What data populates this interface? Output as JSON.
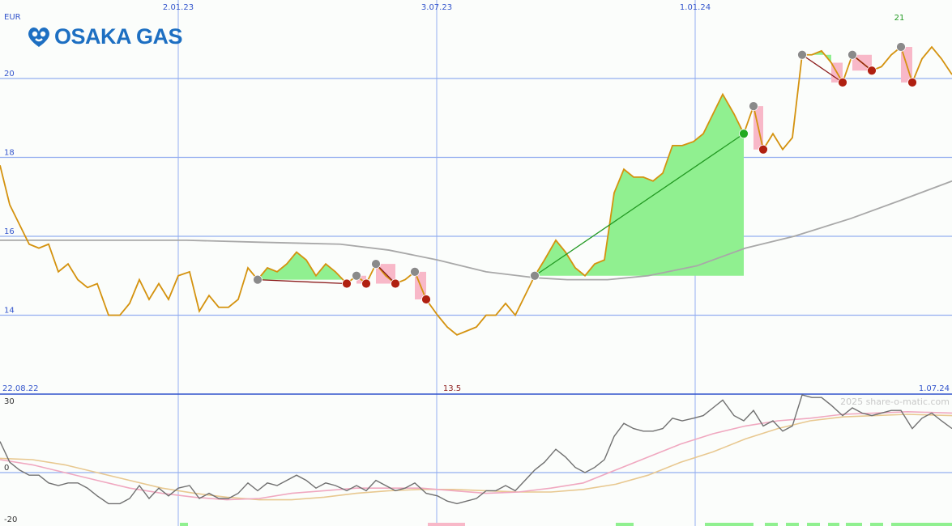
{
  "brand": {
    "name": "OSAKA GAS",
    "color": "#1d6fc2"
  },
  "currency": "EUR",
  "watermark": "2025 share-o-matic.com",
  "chart_data": [
    {
      "type": "line",
      "name": "price-panel",
      "x_tick_labels": [
        "2.01.23",
        "3.07.23",
        "1.01.24"
      ],
      "y_ticks": [
        14,
        16,
        18,
        20
      ],
      "ylim": [
        12.0,
        21.8
      ],
      "start_date_label": "22.08.22",
      "end_date_label": "1.07.24",
      "low_marker_label": "13.5",
      "high_marker_label": "21",
      "grid": true,
      "colors": {
        "price": "#d4920e",
        "moving_average": "#a8a8a8",
        "up_fill": "#90f090",
        "down_fill": "#f8b8c8",
        "trend_up": "#229922",
        "trend_down": "#8b1a1a",
        "grid": "#94aef0",
        "axis_text": "#3355cc"
      },
      "price": [
        [
          0,
          17.8
        ],
        [
          12,
          16.8
        ],
        [
          24,
          16.3
        ],
        [
          36,
          15.8
        ],
        [
          48,
          15.7
        ],
        [
          60,
          15.8
        ],
        [
          72,
          15.1
        ],
        [
          84,
          15.3
        ],
        [
          96,
          14.9
        ],
        [
          108,
          14.7
        ],
        [
          120,
          14.8
        ],
        [
          134,
          14.0
        ],
        [
          148,
          14.0
        ],
        [
          160,
          14.3
        ],
        [
          172,
          14.9
        ],
        [
          184,
          14.4
        ],
        [
          196,
          14.8
        ],
        [
          208,
          14.4
        ],
        [
          220,
          15.0
        ],
        [
          234,
          15.1
        ],
        [
          246,
          14.1
        ],
        [
          258,
          14.5
        ],
        [
          270,
          14.2
        ],
        [
          282,
          14.2
        ],
        [
          294,
          14.4
        ],
        [
          306,
          15.2
        ],
        [
          318,
          14.9
        ],
        [
          330,
          15.2
        ],
        [
          342,
          15.1
        ],
        [
          354,
          15.3
        ],
        [
          366,
          15.6
        ],
        [
          378,
          15.4
        ],
        [
          390,
          15.0
        ],
        [
          402,
          15.3
        ],
        [
          414,
          15.1
        ],
        [
          428,
          14.8
        ],
        [
          440,
          15.0
        ],
        [
          452,
          14.8
        ],
        [
          464,
          15.3
        ],
        [
          476,
          15.0
        ],
        [
          488,
          14.8
        ],
        [
          500,
          14.9
        ],
        [
          512,
          15.1
        ],
        [
          526,
          14.4
        ],
        [
          540,
          14.0
        ],
        [
          552,
          13.7
        ],
        [
          564,
          13.5
        ],
        [
          576,
          13.6
        ],
        [
          588,
          13.7
        ],
        [
          600,
          14.0
        ],
        [
          612,
          14.0
        ],
        [
          624,
          14.3
        ],
        [
          636,
          14.0
        ],
        [
          648,
          14.5
        ],
        [
          660,
          15.0
        ],
        [
          672,
          15.4
        ],
        [
          686,
          15.9
        ],
        [
          698,
          15.6
        ],
        [
          710,
          15.2
        ],
        [
          722,
          15.0
        ],
        [
          734,
          15.3
        ],
        [
          746,
          15.4
        ],
        [
          758,
          17.1
        ],
        [
          770,
          17.7
        ],
        [
          782,
          17.5
        ],
        [
          794,
          17.5
        ],
        [
          806,
          17.4
        ],
        [
          818,
          17.6
        ],
        [
          830,
          18.3
        ],
        [
          842,
          18.3
        ],
        [
          856,
          18.4
        ],
        [
          868,
          18.6
        ],
        [
          880,
          19.1
        ],
        [
          892,
          19.6
        ],
        [
          906,
          19.1
        ],
        [
          918,
          18.6
        ],
        [
          930,
          19.3
        ],
        [
          942,
          18.2
        ],
        [
          954,
          18.6
        ],
        [
          966,
          18.2
        ],
        [
          978,
          18.5
        ],
        [
          990,
          20.6
        ],
        [
          1002,
          20.6
        ],
        [
          1014,
          20.7
        ],
        [
          1026,
          20.4
        ],
        [
          1040,
          19.9
        ],
        [
          1052,
          20.6
        ],
        [
          1064,
          20.4
        ],
        [
          1076,
          20.2
        ],
        [
          1088,
          20.3
        ],
        [
          1100,
          20.6
        ],
        [
          1112,
          20.8
        ],
        [
          1126,
          19.9
        ],
        [
          1138,
          20.5
        ],
        [
          1150,
          20.8
        ],
        [
          1162,
          20.5
        ],
        [
          1175,
          20.1
        ]
      ],
      "moving_average": [
        [
          0,
          15.9
        ],
        [
          100,
          15.9
        ],
        [
          230,
          15.9
        ],
        [
          320,
          15.85
        ],
        [
          420,
          15.8
        ],
        [
          480,
          15.65
        ],
        [
          540,
          15.4
        ],
        [
          600,
          15.1
        ],
        [
          660,
          14.95
        ],
        [
          700,
          14.9
        ],
        [
          750,
          14.9
        ],
        [
          800,
          15.0
        ],
        [
          860,
          15.25
        ],
        [
          920,
          15.7
        ],
        [
          980,
          16.0
        ],
        [
          1050,
          16.45
        ],
        [
          1110,
          16.9
        ],
        [
          1175,
          17.4
        ]
      ],
      "up_fills": [
        {
          "from": 318,
          "to": 428,
          "base": 14.9
        },
        {
          "from": 660,
          "to": 918,
          "base": 15.0
        },
        {
          "from": 990,
          "to": 1026,
          "base": 20.6
        }
      ],
      "down_fills": [
        {
          "from": 440,
          "to": 452,
          "top": 15.0,
          "bottom": 14.8
        },
        {
          "from": 464,
          "to": 488,
          "top": 15.3,
          "bottom": 14.8
        },
        {
          "from": 512,
          "to": 526,
          "top": 15.1,
          "bottom": 14.4
        },
        {
          "from": 930,
          "to": 942,
          "top": 19.3,
          "bottom": 18.2
        },
        {
          "from": 1026,
          "to": 1040,
          "top": 20.4,
          "bottom": 19.9
        },
        {
          "from": 1052,
          "to": 1076,
          "top": 20.6,
          "bottom": 20.2
        },
        {
          "from": 1112,
          "to": 1126,
          "top": 20.8,
          "bottom": 19.9
        }
      ],
      "trend_segments": [
        {
          "x1": 318,
          "y1": 14.9,
          "x2": 428,
          "y2": 14.8,
          "dir": "down"
        },
        {
          "x1": 464,
          "y1": 15.3,
          "x2": 488,
          "y2": 14.8,
          "dir": "down"
        },
        {
          "x1": 660,
          "y1": 15.0,
          "x2": 918,
          "y2": 18.6,
          "dir": "up"
        },
        {
          "x1": 990,
          "y1": 20.6,
          "x2": 1040,
          "y2": 19.9,
          "dir": "down"
        },
        {
          "x1": 1052,
          "y1": 20.6,
          "x2": 1076,
          "y2": 20.2,
          "dir": "down"
        }
      ],
      "markers": [
        {
          "x": 318,
          "y": 14.9,
          "kind": "grey"
        },
        {
          "x": 428,
          "y": 14.8,
          "kind": "red"
        },
        {
          "x": 440,
          "y": 15.0,
          "kind": "grey"
        },
        {
          "x": 452,
          "y": 14.8,
          "kind": "red"
        },
        {
          "x": 464,
          "y": 15.3,
          "kind": "grey"
        },
        {
          "x": 488,
          "y": 14.8,
          "kind": "red"
        },
        {
          "x": 512,
          "y": 15.1,
          "kind": "grey"
        },
        {
          "x": 526,
          "y": 14.4,
          "kind": "red"
        },
        {
          "x": 660,
          "y": 15.0,
          "kind": "grey"
        },
        {
          "x": 918,
          "y": 18.6,
          "kind": "green"
        },
        {
          "x": 930,
          "y": 19.3,
          "kind": "grey"
        },
        {
          "x": 942,
          "y": 18.2,
          "kind": "red"
        },
        {
          "x": 990,
          "y": 20.6,
          "kind": "grey"
        },
        {
          "x": 1040,
          "y": 19.9,
          "kind": "red"
        },
        {
          "x": 1052,
          "y": 20.6,
          "kind": "grey"
        },
        {
          "x": 1076,
          "y": 20.2,
          "kind": "red"
        },
        {
          "x": 1112,
          "y": 20.8,
          "kind": "grey"
        },
        {
          "x": 1126,
          "y": 19.9,
          "kind": "red"
        }
      ]
    },
    {
      "type": "line",
      "name": "momentum-panel",
      "y_ticks": [
        30,
        0,
        -20
      ],
      "ylim": [
        -20,
        30
      ],
      "colors": {
        "momentum": "#707070",
        "fast_avg": "#f0a8c0",
        "slow_avg": "#e8c890",
        "pos_bar": "#90f090",
        "neg_bar": "#f8b8c8"
      },
      "momentum": [
        [
          0,
          12
        ],
        [
          12,
          4
        ],
        [
          24,
          1
        ],
        [
          36,
          -1
        ],
        [
          48,
          -1
        ],
        [
          60,
          -4
        ],
        [
          72,
          -5
        ],
        [
          84,
          -4
        ],
        [
          96,
          -4
        ],
        [
          108,
          -6
        ],
        [
          120,
          -9
        ],
        [
          134,
          -12
        ],
        [
          148,
          -12
        ],
        [
          160,
          -10
        ],
        [
          172,
          -5
        ],
        [
          184,
          -10
        ],
        [
          196,
          -6
        ],
        [
          208,
          -9
        ],
        [
          220,
          -6
        ],
        [
          234,
          -5
        ],
        [
          246,
          -10
        ],
        [
          258,
          -8
        ],
        [
          270,
          -10
        ],
        [
          282,
          -10
        ],
        [
          294,
          -8
        ],
        [
          306,
          -4
        ],
        [
          318,
          -7
        ],
        [
          330,
          -4
        ],
        [
          342,
          -5
        ],
        [
          354,
          -3
        ],
        [
          366,
          -1
        ],
        [
          378,
          -3
        ],
        [
          390,
          -6
        ],
        [
          402,
          -4
        ],
        [
          414,
          -5
        ],
        [
          428,
          -7
        ],
        [
          440,
          -5
        ],
        [
          452,
          -7
        ],
        [
          464,
          -3
        ],
        [
          476,
          -5
        ],
        [
          488,
          -7
        ],
        [
          500,
          -6
        ],
        [
          512,
          -4
        ],
        [
          526,
          -8
        ],
        [
          540,
          -9
        ],
        [
          552,
          -11
        ],
        [
          564,
          -12
        ],
        [
          576,
          -11
        ],
        [
          588,
          -10
        ],
        [
          600,
          -7
        ],
        [
          612,
          -7
        ],
        [
          624,
          -5
        ],
        [
          636,
          -7
        ],
        [
          648,
          -3
        ],
        [
          660,
          1
        ],
        [
          672,
          4
        ],
        [
          686,
          9
        ],
        [
          698,
          6
        ],
        [
          710,
          2
        ],
        [
          722,
          0
        ],
        [
          734,
          2
        ],
        [
          746,
          5
        ],
        [
          758,
          14
        ],
        [
          770,
          19
        ],
        [
          782,
          17
        ],
        [
          794,
          16
        ],
        [
          806,
          16
        ],
        [
          818,
          17
        ],
        [
          830,
          21
        ],
        [
          842,
          20
        ],
        [
          856,
          21
        ],
        [
          868,
          22
        ],
        [
          880,
          25
        ],
        [
          892,
          28
        ],
        [
          906,
          22
        ],
        [
          918,
          20
        ],
        [
          930,
          24
        ],
        [
          942,
          18
        ],
        [
          954,
          20
        ],
        [
          966,
          16
        ],
        [
          978,
          18
        ],
        [
          990,
          30
        ],
        [
          1002,
          29
        ],
        [
          1014,
          29
        ],
        [
          1026,
          26
        ],
        [
          1040,
          22
        ],
        [
          1052,
          25
        ],
        [
          1064,
          23
        ],
        [
          1076,
          22
        ],
        [
          1088,
          23
        ],
        [
          1100,
          24
        ],
        [
          1112,
          24
        ],
        [
          1126,
          17
        ],
        [
          1138,
          21
        ],
        [
          1150,
          23
        ],
        [
          1162,
          20
        ],
        [
          1175,
          17
        ]
      ],
      "fast_avg": [
        [
          0,
          5
        ],
        [
          40,
          3
        ],
        [
          80,
          0
        ],
        [
          120,
          -3
        ],
        [
          160,
          -6
        ],
        [
          200,
          -8
        ],
        [
          240,
          -9.5
        ],
        [
          280,
          -10.5
        ],
        [
          320,
          -10
        ],
        [
          360,
          -8
        ],
        [
          400,
          -7
        ],
        [
          440,
          -6
        ],
        [
          480,
          -6
        ],
        [
          520,
          -6
        ],
        [
          560,
          -7
        ],
        [
          600,
          -8
        ],
        [
          640,
          -7.5
        ],
        [
          680,
          -6
        ],
        [
          720,
          -4
        ],
        [
          760,
          1
        ],
        [
          800,
          6
        ],
        [
          840,
          11
        ],
        [
          880,
          15
        ],
        [
          920,
          18
        ],
        [
          960,
          20
        ],
        [
          1000,
          21
        ],
        [
          1040,
          22.5
        ],
        [
          1080,
          23
        ],
        [
          1120,
          23.5
        ],
        [
          1175,
          23
        ]
      ],
      "slow_avg": [
        [
          0,
          5.5
        ],
        [
          40,
          5
        ],
        [
          80,
          3
        ],
        [
          120,
          0
        ],
        [
          160,
          -3
        ],
        [
          200,
          -6
        ],
        [
          240,
          -8
        ],
        [
          280,
          -9.5
        ],
        [
          320,
          -10.5
        ],
        [
          360,
          -10.5
        ],
        [
          400,
          -9.5
        ],
        [
          440,
          -8
        ],
        [
          480,
          -7
        ],
        [
          520,
          -6.5
        ],
        [
          560,
          -6.5
        ],
        [
          600,
          -7
        ],
        [
          640,
          -7.5
        ],
        [
          680,
          -7.5
        ],
        [
          720,
          -6.5
        ],
        [
          760,
          -4.5
        ],
        [
          800,
          -1
        ],
        [
          840,
          4
        ],
        [
          880,
          8
        ],
        [
          920,
          13
        ],
        [
          960,
          17
        ],
        [
          1000,
          20
        ],
        [
          1040,
          21.5
        ],
        [
          1080,
          22
        ],
        [
          1120,
          22.5
        ],
        [
          1175,
          22
        ]
      ],
      "bars": [
        {
          "from": 222,
          "to": 232,
          "dir": "up"
        },
        {
          "from": 528,
          "to": 574,
          "dir": "down"
        },
        {
          "from": 760,
          "to": 782,
          "dir": "up"
        },
        {
          "from": 870,
          "to": 930,
          "dir": "up"
        },
        {
          "from": 944,
          "to": 960,
          "dir": "up"
        },
        {
          "from": 970,
          "to": 986,
          "dir": "up"
        },
        {
          "from": 996,
          "to": 1012,
          "dir": "up"
        },
        {
          "from": 1022,
          "to": 1036,
          "dir": "up"
        },
        {
          "from": 1044,
          "to": 1064,
          "dir": "up"
        },
        {
          "from": 1074,
          "to": 1090,
          "dir": "up"
        },
        {
          "from": 1100,
          "to": 1175,
          "dir": "up"
        }
      ]
    }
  ]
}
